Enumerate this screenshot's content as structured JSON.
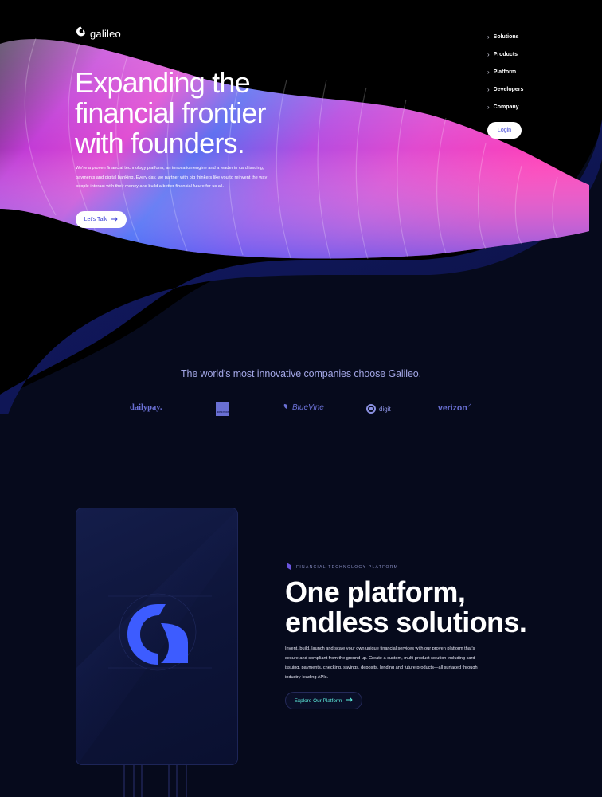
{
  "brand": {
    "name": "galileo"
  },
  "nav": {
    "items": [
      {
        "label": "Solutions"
      },
      {
        "label": "Products"
      },
      {
        "label": "Platform"
      },
      {
        "label": "Developers"
      },
      {
        "label": "Company"
      }
    ],
    "login_label": "Login"
  },
  "hero": {
    "title_lines": [
      "Expanding the",
      "financial frontier",
      "with founders."
    ],
    "description": "We're a proven financial technology platform, an innovation engine and a leader in card issuing, payments and digital banking. Every day, we partner with big thinkers like you to reinvent the way people interact with their money and build a better financial future for us all.",
    "cta_label": "Let's Talk"
  },
  "clients": {
    "title": "The world's most innovative companies choose Galileo.",
    "logos": [
      {
        "name": "dailypay."
      },
      {
        "name": "MONEYLION"
      },
      {
        "name": "BlueVine"
      },
      {
        "name": "digit"
      },
      {
        "name": "verizon"
      }
    ]
  },
  "platform": {
    "eyebrow": "FINANCIAL TECHNOLOGY PLATFORM",
    "title_lines": [
      "One platform,",
      "endless solutions."
    ],
    "description": "Invent, build, launch and scale your own unique financial services with our proven platform that's secure and compliant from the ground up.  Create a custom, multi-product solution including card issuing, payments, checking, savings, deposits, lending and future products—all surfaced through industry-leading APIs.",
    "cta_label": "Explore Our Platform"
  },
  "colors": {
    "accent": "#3a3fd6",
    "cyan": "#5ff0e0",
    "background": "#060a1c",
    "logo_blue": "#3d5cff"
  }
}
